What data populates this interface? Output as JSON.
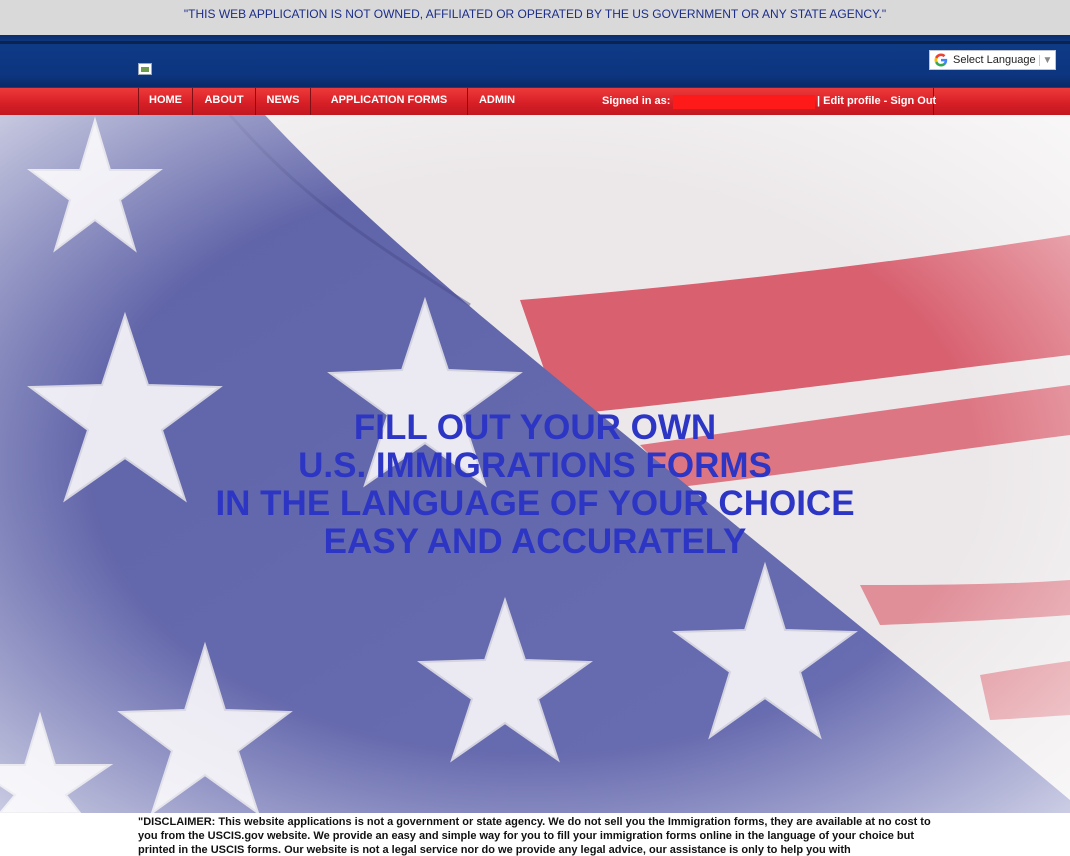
{
  "notice": "\"THIS WEB APPLICATION IS NOT OWNED, AFFILIATED OR OPERATED BY THE US GOVERNMENT OR ANY STATE AGENCY.\"",
  "translate": {
    "label": "Select Language",
    "icon": "google-g-icon",
    "caret": "▼"
  },
  "nav": {
    "items": [
      {
        "label": "HOME"
      },
      {
        "label": "ABOUT"
      },
      {
        "label": "NEWS"
      },
      {
        "label": "APPLICATION FORMS"
      },
      {
        "label": "ADMIN"
      }
    ],
    "signed_in_label": "Signed in as:",
    "separator": "| ",
    "edit_profile": "Edit profile",
    "dash": " - ",
    "sign_out": "Sign Out"
  },
  "hero": {
    "lines": [
      "FILL OUT YOUR OWN",
      "U.S. IMMIGRATIONS FORMS",
      "IN THE LANGUAGE OF YOUR CHOICE",
      "EASY AND ACCURATELY"
    ],
    "text_color": "#2d36c4"
  },
  "disclaimer": "\"DISCLAIMER: This website applications is not a government or state agency. We do not sell you the Immigration forms, they are available at no cost to you from the USCIS.gov website. We provide an easy and simple way for you to fill your immigration forms online in the language of your choice but printed in the USCIS forms. Our website is not a legal service nor do we provide any legal advice, our assistance is only to help you with",
  "colors": {
    "navy": "#0d3580",
    "red": "#d81f27",
    "hero_text": "#2d36c4"
  }
}
